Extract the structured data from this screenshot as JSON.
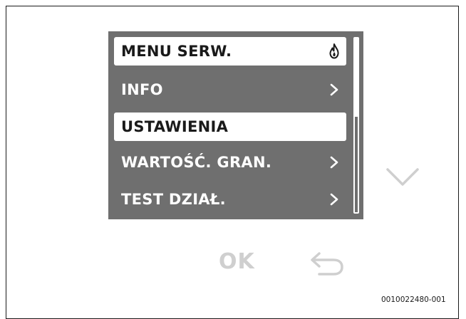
{
  "menu": {
    "items": [
      {
        "label": "MENU SERW.",
        "icon": "flame-icon",
        "selected": true
      },
      {
        "label": "INFO",
        "icon": "chevron-right-icon",
        "selected": false
      },
      {
        "label": "USTAWIENIA",
        "icon": null,
        "selected": true
      },
      {
        "label": "WARTOŚĆ. GRAN.",
        "icon": "chevron-right-icon",
        "selected": false
      },
      {
        "label": "TEST DZIAŁ.",
        "icon": "chevron-right-icon",
        "selected": false
      }
    ],
    "scroll_fraction": 0.45
  },
  "controls": {
    "ok_label": "OK",
    "down_icon": "chevron-down-icon",
    "back_icon": "back-arrow-icon"
  },
  "document": {
    "code": "0010022480-001"
  },
  "colors": {
    "screen": "#6f6f6f",
    "text_light": "#ffffff",
    "text_dark": "#1a1a1a",
    "button_inactive": "#cfcfcf"
  }
}
